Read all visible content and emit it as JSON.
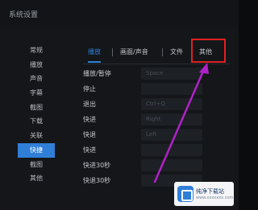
{
  "window": {
    "title": "系统设置"
  },
  "sidebar": {
    "items": [
      {
        "label": "常规",
        "active": false
      },
      {
        "label": "播放",
        "active": false
      },
      {
        "label": "声音",
        "active": false
      },
      {
        "label": "字幕",
        "active": false
      },
      {
        "label": "截图",
        "active": false
      },
      {
        "label": "下载",
        "active": false
      },
      {
        "label": "关联",
        "active": false
      },
      {
        "label": "快捷",
        "active": true
      },
      {
        "label": "截图",
        "active": false
      },
      {
        "label": "其他",
        "active": false
      }
    ]
  },
  "tabs": [
    {
      "label": "播放",
      "active": true
    },
    {
      "label": "画面/声音",
      "active": false
    },
    {
      "label": "文件",
      "active": false
    },
    {
      "label": "其他",
      "active": false
    }
  ],
  "settings": {
    "rows": [
      {
        "label": "播放/暂停",
        "value": "Space"
      },
      {
        "label": "停止",
        "value": ""
      },
      {
        "label": "退出",
        "value": "Ctrl+Q"
      },
      {
        "label": "快进",
        "value": "Right"
      },
      {
        "label": "快退",
        "value": "Left"
      },
      {
        "label": "快进",
        "value": ""
      },
      {
        "label": "快进30秒",
        "value": ""
      },
      {
        "label": "快退30秒",
        "value": ""
      }
    ]
  },
  "watermark": {
    "name": "纯净下载站",
    "url": "www.xxxxxxx.com"
  },
  "colors": {
    "accent": "#2f7fd8",
    "highlight": "#e02020",
    "arrow": "#b021c9"
  }
}
